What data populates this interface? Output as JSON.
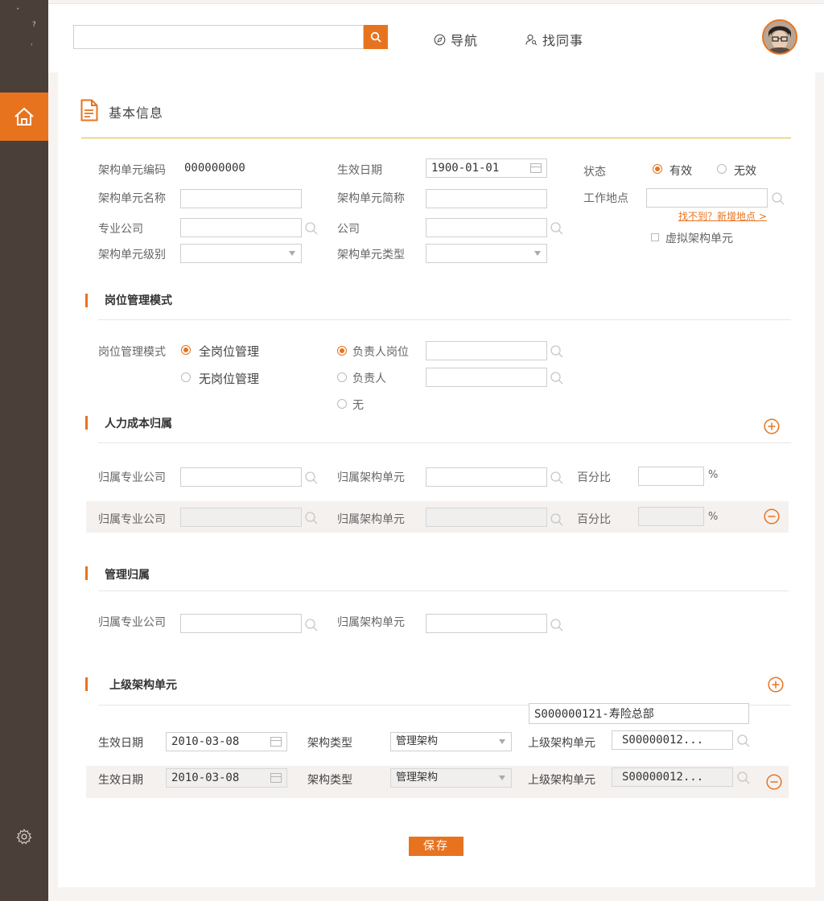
{
  "sidebar": {
    "glyphs": [
      "ˆ",
      "?",
      "ˈ"
    ],
    "home_icon": "home-icon",
    "settings_icon": "gear-icon"
  },
  "header": {
    "search_placeholder": "",
    "nav_label": "导航",
    "find_colleague_label": "找同事"
  },
  "basic_info": {
    "title": "基本信息",
    "code_label": "架构单元编码",
    "code_value": "000000000",
    "effective_date_label": "生效日期",
    "effective_date_value": "1900-01-01",
    "status_label": "状态",
    "status_valid": "有效",
    "status_invalid": "无效",
    "name_label": "架构单元名称",
    "short_name_label": "架构单元简称",
    "work_location_label": "工作地点",
    "add_location_link": "找不到？新增地点 >",
    "professional_company_label": "专业公司",
    "company_label": "公司",
    "virtual_unit_label": "虚拟架构单元",
    "level_label": "架构单元级别",
    "type_label": "架构单元类型"
  },
  "position_mode": {
    "title": "岗位管理模式",
    "label": "岗位管理模式",
    "all_positions": "全岗位管理",
    "no_positions": "无岗位管理",
    "head_position": "负责人岗位",
    "head": "负责人",
    "none": "无"
  },
  "hr_cost": {
    "title": "人力成本归属",
    "rows": [
      {
        "company_label": "归属专业公司",
        "unit_label": "归属架构单元",
        "percent_label": "百分比",
        "percent_unit": "%"
      },
      {
        "company_label": "归属专业公司",
        "unit_label": "归属架构单元",
        "percent_label": "百分比",
        "percent_unit": "%"
      }
    ]
  },
  "management": {
    "title": "管理归属",
    "company_label": "归属专业公司",
    "unit_label": "归属架构单元"
  },
  "parent_unit": {
    "title": "上级架构单元",
    "tooltip": "S000000121-寿险总部",
    "rows": [
      {
        "date_label": "生效日期",
        "date_value": "2010-03-08",
        "type_label": "架构类型",
        "type_value": "管理架构",
        "parent_label": "上级架构单元",
        "parent_value": "S00000012..."
      },
      {
        "date_label": "生效日期",
        "date_value": "2010-03-08",
        "type_label": "架构类型",
        "type_value": "管理架构",
        "parent_label": "上级架构单元",
        "parent_value": "S00000012..."
      }
    ]
  },
  "save_label": "保存",
  "colors": {
    "accent": "#e8731f",
    "sidebar": "#4a3f39",
    "divider_gold": "#e3b53a"
  }
}
